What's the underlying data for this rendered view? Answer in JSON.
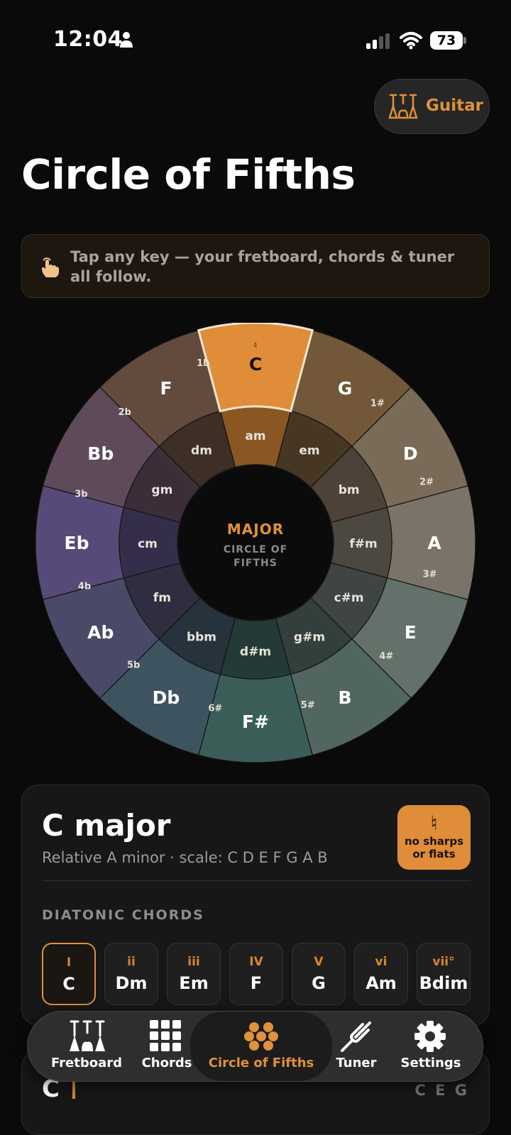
{
  "status_bar": {
    "time": "12:04",
    "battery": "73"
  },
  "instrument": {
    "label": "Guitar"
  },
  "title": "Circle of Fifths",
  "hint": {
    "text": "Tap any key — your fretboard, chords & tuner all follow."
  },
  "wheel": {
    "center_title": "MAJOR",
    "center_subtitle_1": "CIRCLE OF",
    "center_subtitle_2": "FIFTHS",
    "selected_key": "C",
    "keys": [
      {
        "major": "C",
        "minor": "am",
        "sig": "♮",
        "color": "#df8d38"
      },
      {
        "major": "G",
        "minor": "em",
        "sig": "1#",
        "color": "#735739"
      },
      {
        "major": "D",
        "minor": "bm",
        "sig": "2#",
        "color": "#7a6a58"
      },
      {
        "major": "A",
        "minor": "f#m",
        "sig": "3#",
        "color": "#7a7468"
      },
      {
        "major": "E",
        "minor": "c#m",
        "sig": "4#",
        "color": "#64706a"
      },
      {
        "major": "B",
        "minor": "g#m",
        "sig": "5#",
        "color": "#516660"
      },
      {
        "major": "F#",
        "minor": "d#m",
        "sig": "6#",
        "color": "#3a5e57"
      },
      {
        "major": "Db",
        "minor": "bbm",
        "sig": "5b",
        "color": "#3d5360"
      },
      {
        "major": "Ab",
        "minor": "fm",
        "sig": "4b",
        "color": "#4a4a68"
      },
      {
        "major": "Eb",
        "minor": "cm",
        "sig": "3b",
        "color": "#564a78"
      },
      {
        "major": "Bb",
        "minor": "gm",
        "sig": "2b",
        "color": "#5f4a5c"
      },
      {
        "major": "F",
        "minor": "dm",
        "sig": "1b",
        "color": "#624a3d"
      }
    ]
  },
  "key_card": {
    "name": "C major",
    "relative": "Relative A minor · scale: C D E F G A B",
    "badge_symbol": "♮",
    "badge_line1": "no sharps",
    "badge_line2": "or flats",
    "diatonic_label": "DIATONIC CHORDS",
    "chords": [
      {
        "num": "I",
        "name": "C"
      },
      {
        "num": "ii",
        "name": "Dm"
      },
      {
        "num": "iii",
        "name": "Em"
      },
      {
        "num": "IV",
        "name": "F"
      },
      {
        "num": "V",
        "name": "G"
      },
      {
        "num": "vi",
        "name": "Am"
      },
      {
        "num": "vii°",
        "name": "Bdim"
      }
    ]
  },
  "chord_card": {
    "chord": "C",
    "notes": "C E G"
  },
  "tabs": [
    {
      "label": "Fretboard",
      "icon": "guitars-icon"
    },
    {
      "label": "Chords",
      "icon": "grid-icon"
    },
    {
      "label": "Circle of Fifths",
      "icon": "flower-icon"
    },
    {
      "label": "Tuner",
      "icon": "tuning-fork-icon"
    },
    {
      "label": "Settings",
      "icon": "gear-icon"
    }
  ],
  "active_tab": "Circle of Fifths",
  "colors": {
    "accent": "#e0913a",
    "background": "#0a0a0a"
  }
}
